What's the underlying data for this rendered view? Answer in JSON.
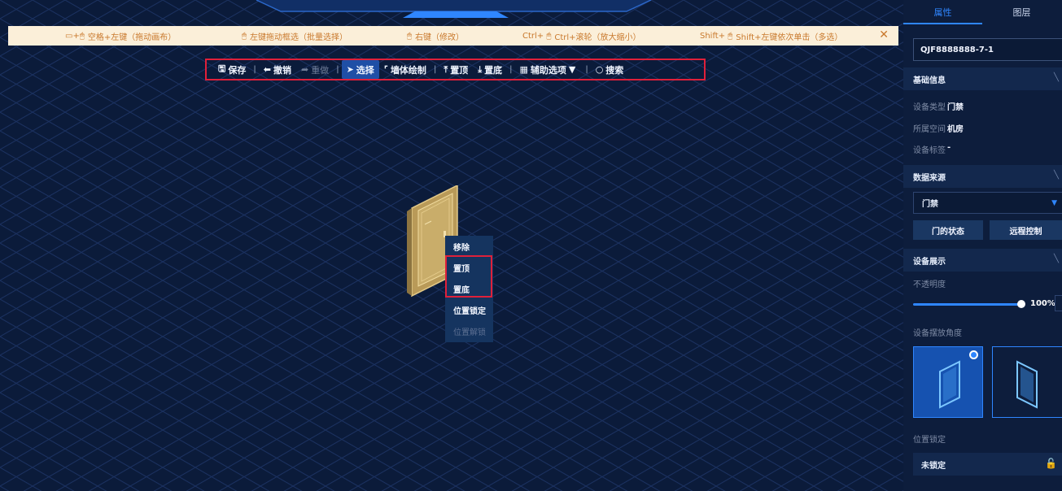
{
  "hints": [
    {
      "icon": "▭+🖱",
      "text": "空格+左键（拖动画布）"
    },
    {
      "icon": "🖱",
      "text": "左键拖动框选（批量选择）"
    },
    {
      "icon": "🖱",
      "text": "右键（修改）"
    },
    {
      "icon": "Ctrl+ 🖱",
      "text": "Ctrl+滚轮（放大缩小）"
    },
    {
      "icon": "Shift+ 🖱",
      "text": "Shift+左键依次单击（多选）"
    }
  ],
  "hint_close": "✕",
  "toolbar": {
    "save": "保存",
    "undo": "撤销",
    "redo": "重做",
    "select": "选择",
    "wall_draw": "墙体绘制",
    "to_top": "置顶",
    "to_bottom": "置底",
    "aux_options": "辅助选项",
    "search": "搜索",
    "sep": "|"
  },
  "context_menu": {
    "remove": "移除",
    "to_top": "置顶",
    "to_bottom": "置底",
    "lock_position": "位置锁定",
    "unlock_position": "位置解锁"
  },
  "panel": {
    "tabs": {
      "properties": "属性",
      "layers": "图层"
    },
    "device_name": "QJF8888888-7-1",
    "basic_info": {
      "title": "基础信息",
      "type_label": "设备类型",
      "type_value": "门禁",
      "space_label": "所属空间",
      "space_value": "机房",
      "tag_label": "设备标签",
      "tag_value": "-"
    },
    "data_source": {
      "title": "数据来源",
      "selected": "门禁",
      "door_status_button": "门的状态",
      "remote_control_button": "远程控制"
    },
    "display": {
      "title": "设备展示",
      "opacity_label": "不透明度",
      "opacity_value": "100%",
      "opacity": 1.0,
      "angle_label": "设备摆放角度"
    },
    "lock": {
      "title": "位置锁定",
      "status": "未锁定"
    }
  },
  "colors": {
    "accent": "#2f86ff",
    "highlight_border": "#e0203a",
    "hint_bg": "#fbefd9",
    "hint_text": "#c9792d",
    "canvas_bg": "#0b1b3a"
  }
}
